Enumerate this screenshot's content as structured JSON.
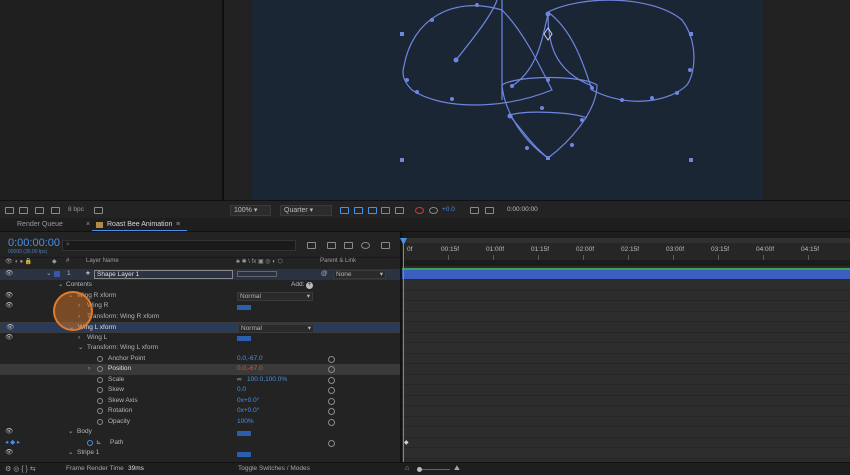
{
  "left_toolbar": {
    "bpc": "8 bpc"
  },
  "viewer_toolbar": {
    "zoom": "100%",
    "resolution": "Quarter",
    "exposure": "+0.0",
    "timecode": "0:00:00:00"
  },
  "tabs": [
    {
      "label": "Render Queue"
    },
    {
      "label": "Roast Bee Animation"
    }
  ],
  "timeline": {
    "current_time": "0:00:00:00",
    "fps_note": "00000 (30.00 fps)",
    "search_placeholder": "",
    "col_layer_name": "Layer Name",
    "col_parent": "Parent & Link",
    "parent_value": "None",
    "ruler_labels": [
      "0f",
      "00:15f",
      "01:00f",
      "01:15f",
      "02:00f",
      "02:15f",
      "03:00f",
      "03:15f",
      "04:00f",
      "04:15f"
    ]
  },
  "layers": {
    "layer_num": "1",
    "layer_name": "Shape Layer 1",
    "contents": "Contents",
    "add": "Add:",
    "wing_r_xform": "Wing R xform",
    "wing_r": "Wing R",
    "transform_wing_r": "Transform: Wing R xform",
    "wing_l_xform": "Wing L xform",
    "wing_l": "Wing L",
    "transform_wing_l": "Transform: Wing L xform",
    "blend_normal": "Normal",
    "anchor_point": "Anchor Point",
    "anchor_value": "0.0,-67.0",
    "position": "Position",
    "position_value": "0.0,-67.0",
    "scale": "Scale",
    "scale_value": "100.0,100.0%",
    "skew": "Skew",
    "skew_value": "0.0",
    "skew_axis": "Skew Axis",
    "skew_axis_value": "0x+0.0°",
    "rotation": "Rotation",
    "rotation_value": "0x+0.0°",
    "opacity": "Opacity",
    "opacity_value": "100%",
    "body": "Body",
    "path": "Path",
    "stripe": "Stripe 1"
  },
  "status": {
    "frame_render_label": "Frame Render Time",
    "frame_render_value": "39ms",
    "toggle_label": "Toggle Switches / Modes"
  },
  "colors": {
    "accent_blue": "#4a90e6",
    "shape_stroke": "#6f86e0",
    "canvas_bg": "#1b2634",
    "error_red": "#e84a3f",
    "cursor_highlight": "#e07b2a"
  }
}
